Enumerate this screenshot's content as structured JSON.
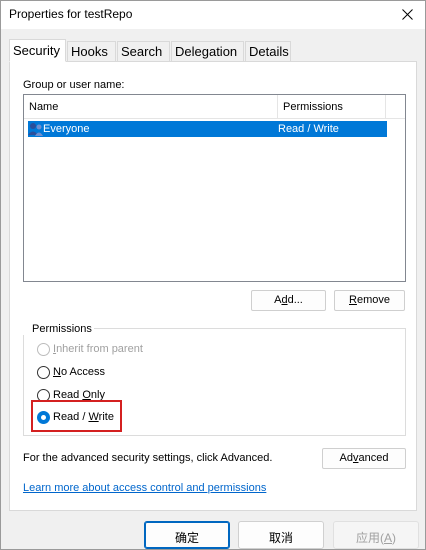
{
  "window": {
    "title": "Properties for testRepo"
  },
  "tabs": [
    {
      "label": "Security",
      "active": true
    },
    {
      "label": "Hooks"
    },
    {
      "label": "Search"
    },
    {
      "label": "Delegation"
    },
    {
      "label": "Details"
    }
  ],
  "security": {
    "group_label": "Group or user name:",
    "columns": [
      "Name",
      "Permissions"
    ],
    "rows": [
      {
        "name": "Everyone",
        "permission": "Read / Write",
        "selected": true,
        "icon": "group-users-icon"
      }
    ],
    "add_button": {
      "pre": "A",
      "accel": "d",
      "post": "d..."
    },
    "remove_button": {
      "accel": "R",
      "post": "emove"
    },
    "permissions_group": "Permissions",
    "radios": [
      {
        "accel": "I",
        "post": "nherit from parent",
        "state": "disabled"
      },
      {
        "accel": "N",
        "post": "o Access",
        "state": "unchecked"
      },
      {
        "pre": "Read ",
        "accel": "O",
        "post": "nly",
        "state": "unchecked"
      },
      {
        "pre": "Read / ",
        "accel": "W",
        "post": "rite",
        "state": "checked"
      }
    ],
    "advanced_text": "For the advanced security settings, click Advanced.",
    "advanced_button": {
      "pre": "Ad",
      "accel": "v",
      "post": "anced"
    },
    "learn_more_link": "Learn more about access control and permissions"
  },
  "footer": {
    "ok": "确定",
    "cancel": "取消",
    "apply_pre": "应用(",
    "apply_accel": "A",
    "apply_post": ")"
  },
  "colors": {
    "selection": "#0078d7",
    "highlight_border": "#d42020",
    "link": "#0066cc"
  }
}
